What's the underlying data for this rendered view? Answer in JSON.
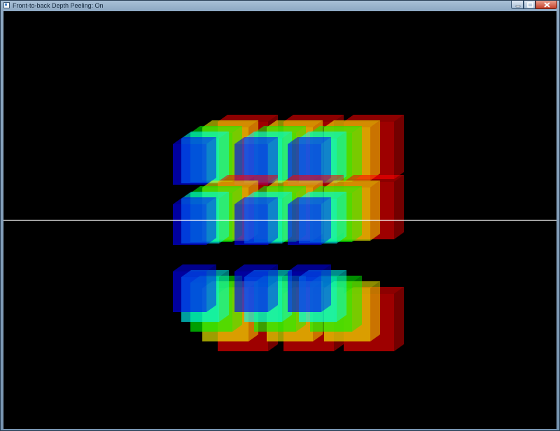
{
  "window": {
    "title": "Front-to-back Depth Peeling: On",
    "app_icon": "application-icon",
    "controls": [
      {
        "name": "minimize-button",
        "icon": "minimize-icon"
      },
      {
        "name": "maximize-button",
        "icon": "maximize-icon"
      },
      {
        "name": "close-button",
        "icon": "close-icon"
      }
    ]
  },
  "scene": {
    "background": "#000000",
    "horizon_line_color": "#ffffff",
    "cube_colors": [
      "#ff0000",
      "#ffff00",
      "#00ff00",
      "#00ffff",
      "#0000ff"
    ],
    "rows": 3
  }
}
